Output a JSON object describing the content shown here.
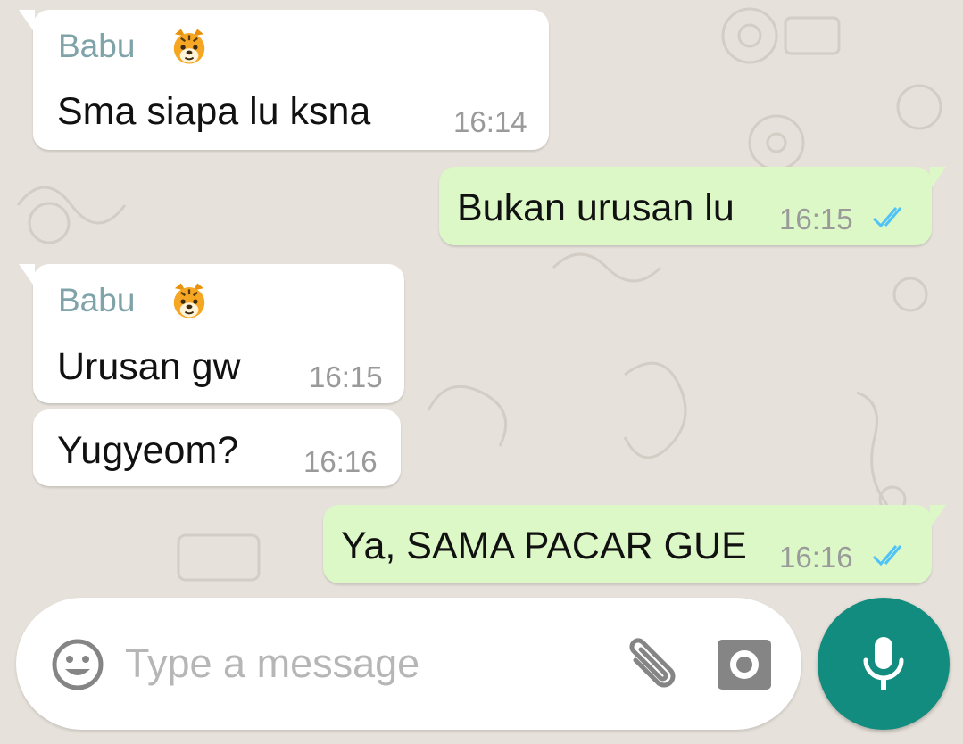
{
  "messages": [
    {
      "direction": "in",
      "sender": "Babu",
      "sender_emoji": "tiger-face",
      "text": "Sma siapa lu ksna",
      "time": "16:14"
    },
    {
      "direction": "out",
      "text": "Bukan urusan lu",
      "time": "16:15",
      "status": "read"
    },
    {
      "direction": "in",
      "sender": "Babu",
      "sender_emoji": "tiger-face",
      "text": "Urusan gw",
      "time": "16:15"
    },
    {
      "direction": "in",
      "text": "Yugyeom?",
      "time": "16:16"
    },
    {
      "direction": "out",
      "text": "Ya, SAMA PACAR GUE",
      "time": "16:16",
      "status": "read"
    }
  ],
  "input": {
    "placeholder": "Type a message",
    "emoji_icon": "smiley-icon",
    "attach_icon": "paperclip-icon",
    "camera_icon": "camera-icon"
  },
  "mic_button": {
    "icon": "microphone-icon"
  },
  "colors": {
    "background": "#e6e1da",
    "incoming_bubble": "#ffffff",
    "outgoing_bubble": "#dcf8c6",
    "sender_name": "#7fa3a8",
    "read_ticks": "#4fc3f7",
    "accent": "#128c7e"
  }
}
